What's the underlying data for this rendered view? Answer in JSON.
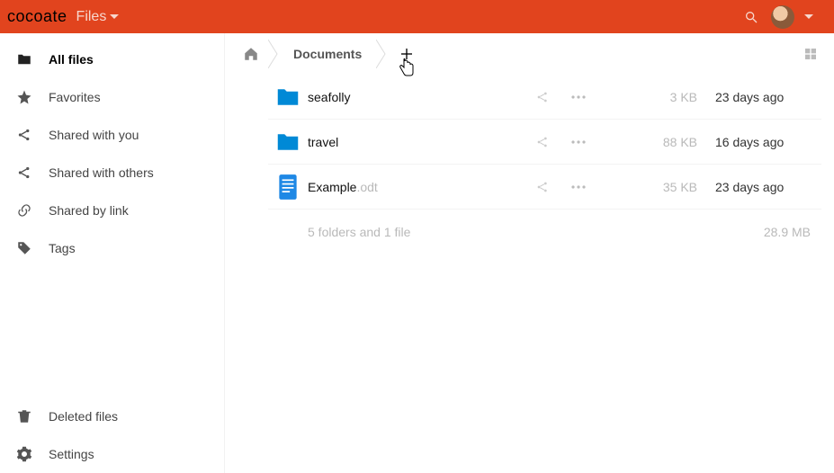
{
  "header": {
    "brand": "cocoate",
    "app_name": "Files"
  },
  "sidebar": {
    "items": [
      {
        "label": "All files",
        "active": true
      },
      {
        "label": "Favorites"
      },
      {
        "label": "Shared with you"
      },
      {
        "label": "Shared with others"
      },
      {
        "label": "Shared by link"
      },
      {
        "label": "Tags"
      }
    ],
    "bottom": [
      {
        "label": "Deleted files"
      },
      {
        "label": "Settings"
      }
    ]
  },
  "breadcrumb": {
    "current": "Documents"
  },
  "files": [
    {
      "name": "seafolly",
      "ext": "",
      "type": "folder",
      "size": "3 KB",
      "date": "23 days ago"
    },
    {
      "name": "travel",
      "ext": "",
      "type": "folder",
      "size": "88 KB",
      "date": "16 days ago"
    },
    {
      "name": "Example",
      "ext": ".odt",
      "type": "document",
      "size": "35 KB",
      "date": "23 days ago"
    }
  ],
  "summary": {
    "label": "5 folders and 1 file",
    "size": "28.9 MB"
  }
}
